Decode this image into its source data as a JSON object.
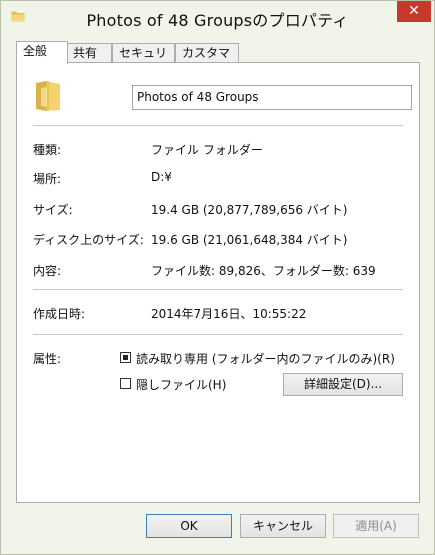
{
  "window": {
    "title": "Photos of 48 Groupsのプロパティ",
    "close_symbol": "✕"
  },
  "tabs": [
    {
      "label": "全般",
      "active": true
    },
    {
      "label": "共有",
      "active": false
    },
    {
      "label": "セキュリティ",
      "active": false
    },
    {
      "label": "カスタマイズ",
      "active": false
    }
  ],
  "general": {
    "folder_name": "Photos of 48 Groups",
    "rows": {
      "type": {
        "label": "種類:",
        "value": "ファイル フォルダー"
      },
      "location": {
        "label": "場所:",
        "value": "D:¥"
      },
      "size": {
        "label": "サイズ:",
        "value": "19.4 GB (20,877,789,656 バイト)"
      },
      "size_on_disk": {
        "label": "ディスク上のサイズ:",
        "value": "19.6 GB (21,061,648,384 バイト)"
      },
      "contains": {
        "label": "内容:",
        "value": "ファイル数: 89,826、フォルダー数: 639"
      },
      "created": {
        "label": "作成日時:",
        "value": "2014年7月16日、10:55:22"
      }
    },
    "attributes": {
      "label": "属性:",
      "read_only": {
        "label": "読み取り専用 (フォルダー内のファイルのみ)(R)",
        "state": "indeterminate"
      },
      "hidden": {
        "label": "隠しファイル(H)",
        "checked": false
      },
      "advanced_button": "詳細設定(D)..."
    }
  },
  "footer": {
    "ok": "OK",
    "cancel": "キャンセル",
    "apply": "適用(A)"
  },
  "colors": {
    "folder": "#f2d16b",
    "close_button": "#c7392d",
    "default_button_border": "#3c7fb1"
  }
}
